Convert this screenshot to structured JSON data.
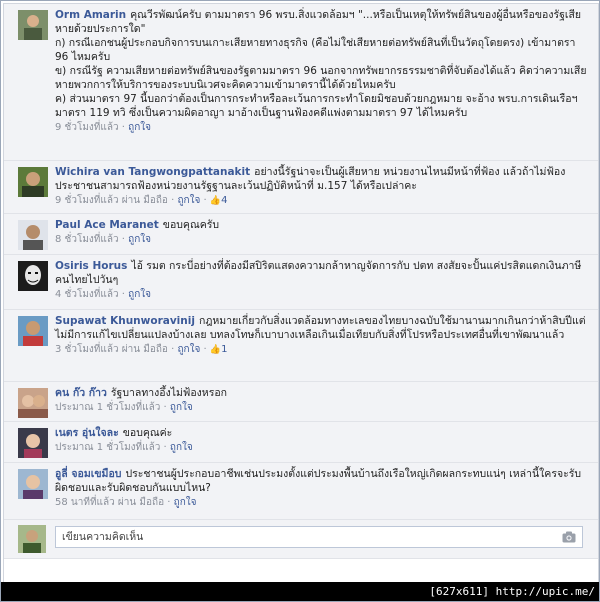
{
  "comments": [
    {
      "author": "Orm Amarin",
      "text": "คุณวีรพัฒน์ครับ ตามมาตรา 96 พรบ.สิ่งแวดล้อมฯ \"...หรือเป็นเหตุให้ทรัพย์สินของผู้อื่นหรือของรัฐเสียหายด้วยประการใด\"\nก) กรณีเอกชนผู้ประกอบกิจการบนเกาะเสียหายทางธุรกิจ (คือไม่ใช่เสียหายต่อทรัพย์สินที่เป็นวัตถุโดยตรง) เข้ามาตรา 96 ไหมครับ\nข) กรณีรัฐ ความเสียหายต่อทรัพย์สินของรัฐตามมาตรา 96 นอกจากทรัพยากรธรรมชาติที่จับต้องได้แล้ว คิดว่าความเสียหายพวกการให้บริการของระบบนิเวศจะคิดความเข้ามาตรานี้ได้ด้วยไหมครับ\nค) ส่วนมาตรา 97 นี้บอกว่าต้องเป็นการกระทำหรือละเว้นการกระทำโดยมิชอบด้วยกฎหมาย จะอ้าง พรบ.การเดินเรือฯ มาตรา 119 ทวิ ซึ่งเป็นความผิดอาญา มาอ้างเป็นฐานฟ้องคดีแพ่งตามมาตรา 97 ได้ไหมครับ",
      "time": "9 ชั่วโมงที่แล้ว",
      "sep": "·",
      "like": "ถูกใจ"
    },
    {
      "author": "Wichira van Tangwongpattanakit",
      "text": "อย่างนี้รัฐน่าจะเป็นผู้เสียหาย หน่วยงานไหนมีหน้าที่ฟ้อง แล้วถ้าไม่ฟ้อง ประชาชนสามารถฟ้องหน่วยงานรัฐฐานละเว้นปฏิบัติหน้าที่ ม.157 ได้หรือเปล่าคะ",
      "time": "9 ชั่วโมงที่แล้ว",
      "via": "ผ่าน มือถือ",
      "sep": "·",
      "like": "ถูกใจ",
      "like_count": "4",
      "like_icon": "👍"
    },
    {
      "author": "Paul Ace Maranet",
      "text": "ขอบคุณครับ",
      "time": "8 ชั่วโมงที่แล้ว",
      "sep": "·",
      "like": "ถูกใจ"
    },
    {
      "author": "Osiris Horus",
      "text": "ไอ้ รมต กระบี่อย่างที่ต้องมีสปิริตแสดงความกล้าหาญจัดการกับ ปตท สงสัยจะปั้นแค่ปรสิตแดกเงินภาษีคนไทยไปวันๆ",
      "time": "4 ชั่วโมงที่แล้ว",
      "sep": "·",
      "like": "ถูกใจ"
    },
    {
      "author": "Supawat Khunworavinij",
      "text": "กฎหมายเกี่ยวกับสิ่งแวดล้อมทางทะเลของไทยบางฉบับใช้มานานมากเกินกว่าห้าสิบปีแต่ไม่มีการแก้ไขเปลี่ยนแปลงบ้างเลย บทลงโทษก็เบาบางเหลือเกินเมื่อเทียบกับสิ่งที่โปรหรือประเทศอื่นที่เขาพัฒนาแล้ว",
      "time": "3 ชั่วโมงที่แล้ว",
      "via": "ผ่าน มือถือ",
      "sep": "·",
      "like": "ถูกใจ",
      "like_count": "1",
      "like_icon": "👍"
    },
    {
      "author": "คน ก๊ว ก๊าว",
      "text": "รัฐบาลทางอึ้งไม่ฟ้องหรอก",
      "time": "ประมาณ 1 ชั่วโมงที่แล้ว",
      "sep": "·",
      "like": "ถูกใจ"
    },
    {
      "author": "เนตร อุ่นใจละ",
      "text": "ขอบคุณค่ะ",
      "time": "ประมาณ 1 ชั่วโมงที่แล้ว",
      "sep": "·",
      "like": "ถูกใจ"
    },
    {
      "author": "อูลี่ จอมเขมือบ",
      "text": "ประชาชนผู้ประกอบอาชีพเช่นประมงตั้งแต่ประมงพื้นบ้านถึงเรือใหญ่เกิดผลกระทบแน่ๆ เหล่านี้ใครจะรับผิดชอบและรับผิดชอบกันแบบไหน?",
      "time": "58 นาทีที่แล้ว",
      "via": "ผ่าน มือถือ",
      "sep": "·",
      "like": "ถูกใจ"
    }
  ],
  "composer": {
    "placeholder": "เขียนความคิดเห็น",
    "camera_icon": "camera-icon"
  },
  "footer": {
    "text": "[627x611] http://upic.me/"
  },
  "colors": {
    "link": "#3b5998",
    "bg": "#f2f3f6",
    "meta": "#8a8f99"
  }
}
